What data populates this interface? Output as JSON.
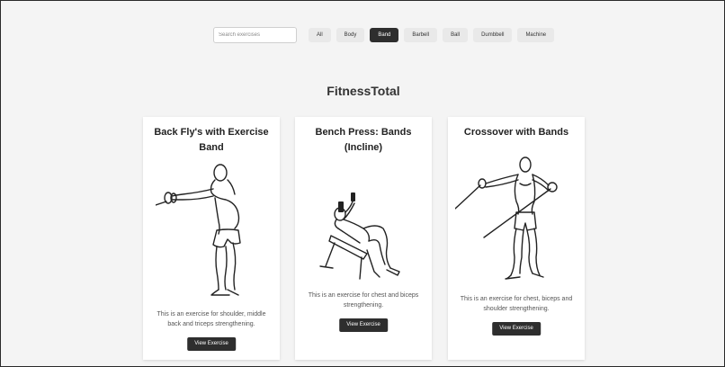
{
  "search": {
    "placeholder": "Search exercises",
    "value": ""
  },
  "filters": [
    {
      "label": "All",
      "active": false
    },
    {
      "label": "Body",
      "active": false
    },
    {
      "label": "Band",
      "active": true
    },
    {
      "label": "Barbell",
      "active": false
    },
    {
      "label": "Ball",
      "active": false
    },
    {
      "label": "Dumbbell",
      "active": false
    },
    {
      "label": "Machine",
      "active": false
    }
  ],
  "site": {
    "title": "FitnessTotal"
  },
  "cards": [
    {
      "title": "Back Fly's with Exercise Band",
      "description": "This is an exercise for shoulder, middle back and triceps strengthening.",
      "button": "View Exercise",
      "illustration": "back-fly-illustration-icon"
    },
    {
      "title": "Bench Press: Bands (Incline)",
      "description": "This is an exercise for chest and biceps strengthening.",
      "button": "View Exercise",
      "illustration": "incline-bench-press-illustration-icon"
    },
    {
      "title": "Crossover with Bands",
      "description": "This is an exercise for chest, biceps and shoulder strengthening.",
      "button": "View Exercise",
      "illustration": "band-crossover-illustration-icon"
    }
  ]
}
